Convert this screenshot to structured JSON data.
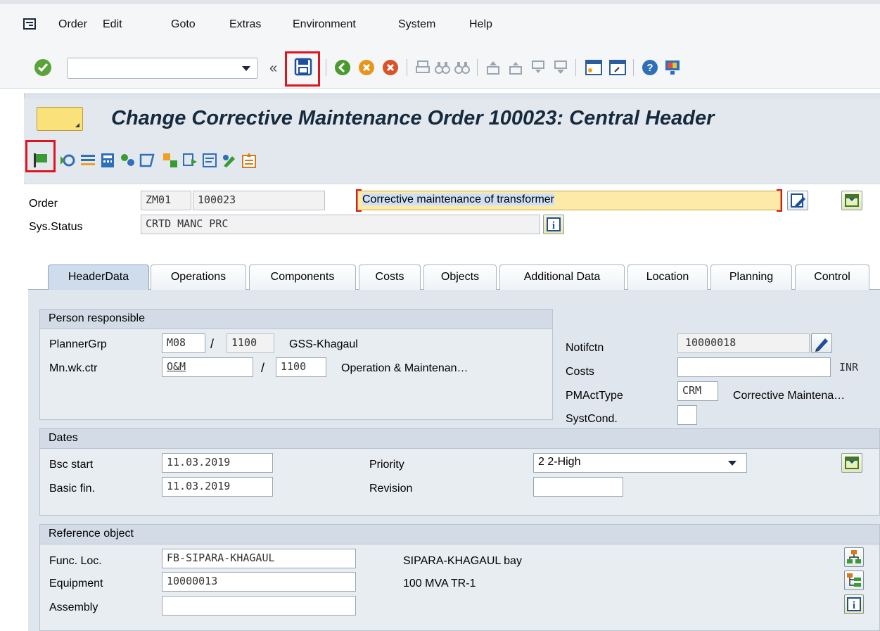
{
  "menu": [
    "Order",
    "Edit",
    "Goto",
    "Extras",
    "Environment",
    "System",
    "Help"
  ],
  "toolbar": {
    "command_field_value": "",
    "back_glyph": "«"
  },
  "title": "Change Corrective Maintenance Order 100023: Central Header",
  "header": {
    "order_label": "Order",
    "order_type": "ZM01",
    "order_number": "100023",
    "description": "Corrective maintenance of transformer",
    "sys_status_label": "Sys.Status",
    "sys_status": "CRTD MANC PRC"
  },
  "tabs": [
    "HeaderData",
    "Operations",
    "Components",
    "Costs",
    "Objects",
    "Additional Data",
    "Location",
    "Planning",
    "Control"
  ],
  "active_tab": "HeaderData",
  "person_responsible": {
    "heading": "Person responsible",
    "planner_label": "PlannerGrp",
    "planner_group": "M08",
    "planner_plant": "1100",
    "planner_text": "GSS-Khagaul",
    "workctr_label": "Mn.wk.ctr",
    "work_center": "O&M",
    "work_center_plant": "1100",
    "work_center_text": "Operation & Maintenan…",
    "slash": "/"
  },
  "side_fields": {
    "notif_label": "Notifctn",
    "notification": "10000018",
    "costs_label": "Costs",
    "costs_value": "",
    "currency": "INR",
    "pmact_label": "PMActType",
    "pmact_code": "CRM",
    "pmact_text": "Corrective Maintena…",
    "systcond_label": "SystCond.",
    "systcond_value": ""
  },
  "dates": {
    "heading": "Dates",
    "bsc_start_label": "Bsc start",
    "bsc_start": "11.03.2019",
    "basic_fin_label": "Basic fin.",
    "basic_fin": "11.03.2019",
    "priority_label": "Priority",
    "priority": "2 2-High",
    "revision_label": "Revision",
    "revision": ""
  },
  "reference_object": {
    "heading": "Reference object",
    "funcloc_label": "Func. Loc.",
    "func_loc": "FB-SIPARA-KHAGAUL",
    "func_loc_text": "SIPARA-KHAGAUL bay",
    "equipment_label": "Equipment",
    "equipment": "10000013",
    "equipment_text": "100 MVA TR-1",
    "assembly_label": "Assembly",
    "assembly": ""
  },
  "colors": {
    "highlight_red": "#e0141e",
    "title": "#162a3e",
    "yellow": "#fbe17a"
  }
}
